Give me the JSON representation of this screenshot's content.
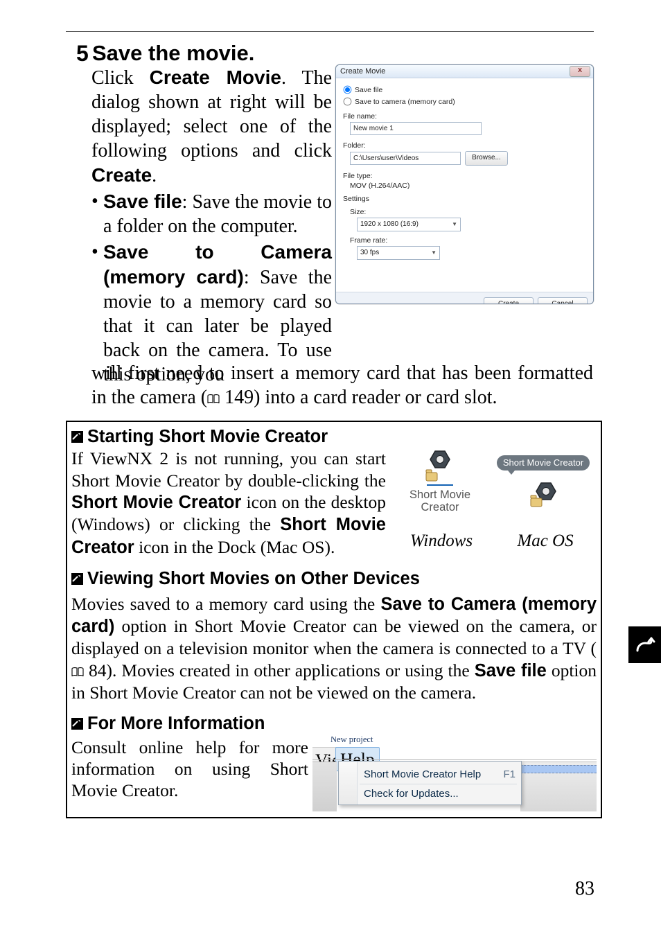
{
  "step": {
    "number": "5",
    "heading": "Save the movie.",
    "body_pre": "Click ",
    "body_bold": "Create Movie",
    "body_post": ". The dialog shown at right will be displayed; select one of the following options and click ",
    "body_bold2": "Create",
    "body_post2": ".",
    "bullet1_bold": "Save file",
    "bullet1_text": ": Save the movie to a folder on the computer.",
    "bullet2_bold": "Save to Camera (memory card)",
    "bullet2_text": ": Save the movie to a memory card so that it can later be played back on the camera. To use this option, you",
    "cont_text_pre": "will first need to insert a memory card that has been formatted in the camera (",
    "cont_ref": "149",
    "cont_text_post": ") into a card reader or card slot."
  },
  "dialog": {
    "title": "Create Movie",
    "close": "x",
    "radio_save_file": "Save file",
    "radio_save_camera": "Save to camera (memory card)",
    "file_name_label": "File name:",
    "file_name_value": "New movie 1",
    "folder_label": "Folder:",
    "folder_value": "C:\\Users\\user\\Videos",
    "browse": "Browse...",
    "file_type_label": "File type:",
    "file_type_value": "MOV (H.264/AAC)",
    "settings_label": "Settings",
    "size_label": "Size:",
    "size_value": "1920 x 1080 (16:9)",
    "fr_label": "Frame rate:",
    "fr_value": "30 fps",
    "create": "Create",
    "cancel": "Cancel"
  },
  "info": {
    "h1": "Starting Short Movie Creator",
    "p1_pre": "If ViewNX 2 is not running, you can start Short Movie Creator by double-clicking the ",
    "p1_b1": "Short Movie Creator",
    "p1_mid": " icon on the desktop (Windows) or clicking the ",
    "p1_b2": "Short Movie Creator",
    "p1_post": " icon in the Dock (Mac OS).",
    "win_icon_caption": "Short Movie Creator",
    "mac_bubble": "Short Movie Creator",
    "os_win": "Windows",
    "os_mac": "Mac OS",
    "h2": "Viewing Short Movies on Other Devices",
    "p2_pre": "Movies saved to a memory card using the ",
    "p2_b1": "Save to Camera (memory card)",
    "p2_mid1": " option in Short Movie Creator can be viewed on the camera, or displayed on a television monitor when the camera is connected to a TV (",
    "p2_ref": "84",
    "p2_mid2": "). Movies created in other applications or using the ",
    "p2_b2": "Save file",
    "p2_post": " option in Short Movie Creator can not be viewed on the camera.",
    "h3": "For More Information",
    "p3": "Consult online help for more information on using Short Movie Creator.",
    "help_menu": {
      "new_project": "New project",
      "view": "View",
      "help": "Help",
      "item1": "Short Movie Creator Help",
      "item1_key": "F1",
      "item2": "Check for Updates..."
    }
  },
  "page_number": "83"
}
